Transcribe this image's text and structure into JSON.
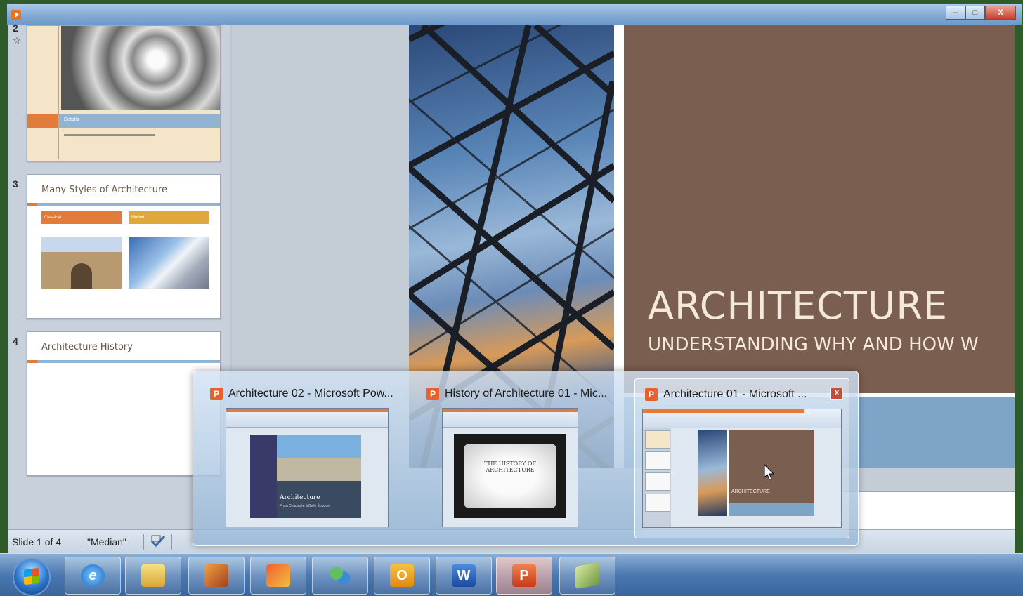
{
  "window": {
    "controls": [
      "–",
      "□",
      "X"
    ]
  },
  "slide_panel": {
    "slides": [
      {
        "number": "2",
        "band_text": "Details"
      },
      {
        "number": "3",
        "title": "Many Styles of Architecture",
        "col1": "Classical",
        "col2": "Modern"
      },
      {
        "number": "4",
        "title": "Architecture History"
      }
    ]
  },
  "main_slide": {
    "title": "ARCHITECTURE",
    "subtitle": "UNDERSTANDING WHY AND HOW W"
  },
  "status": {
    "slide_info": "Slide 1 of 4",
    "theme": "\"Median\""
  },
  "peek": {
    "windows": [
      {
        "title": "Architecture 02 - Microsoft Pow...",
        "thumb_title": "Architecture",
        "thumb_sub": "From Chaussée à Belle Époque"
      },
      {
        "title": "History of Architecture 01 - Mic...",
        "thumb_title": "THE HISTORY OF ARCHITECTURE",
        "thumb_sub": ""
      },
      {
        "title": "Architecture 01 - Microsoft ...",
        "thumb_title": "ARCHITECTURE",
        "thumb_sub": ""
      }
    ],
    "close_glyph": "X"
  },
  "taskbar": {
    "apps": [
      "start-orb",
      "internet-explorer",
      "windows-explorer",
      "media-player",
      "snipping-tool",
      "live-messenger",
      "outlook",
      "word",
      "powerpoint",
      "publisher"
    ],
    "glyphs": {
      "outlook": "O",
      "word": "W",
      "powerpoint": "P"
    }
  },
  "colors": {
    "slide_brown": "#7a5e50",
    "slide_blue": "#7ea4c8",
    "accent_orange": "#e07b3c"
  }
}
